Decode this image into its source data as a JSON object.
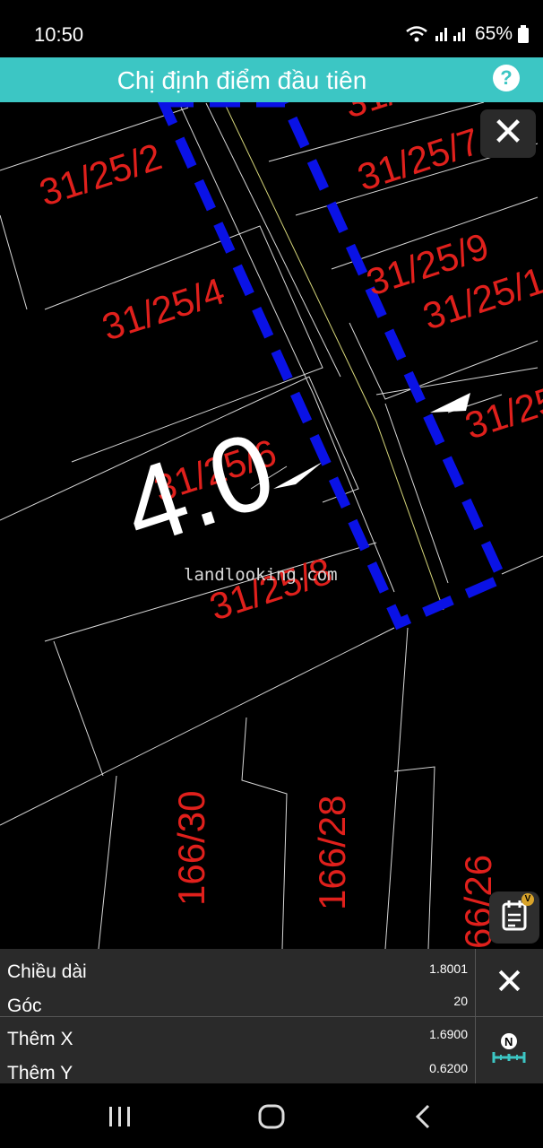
{
  "status": {
    "time": "10:50",
    "battery": "65%"
  },
  "header": {
    "title": "Chị định điểm đầu tiên",
    "help_label": "?"
  },
  "map": {
    "parcels": [
      "31/25/2",
      "31/25/4",
      "31/25/6",
      "31/25/8",
      "31/25/7",
      "31/25/9",
      "31/25/1",
      "31/25",
      "31/",
      "166/30",
      "166/28",
      "66/26"
    ],
    "measure_label": "4.0",
    "watermark": "landlooking.com",
    "close_label": "✕"
  },
  "note_badge": "V",
  "panel": {
    "rows": [
      {
        "label": "Chiều dài",
        "value": "1.8001"
      },
      {
        "label": "Góc",
        "value": "20"
      },
      {
        "label": "Thêm X",
        "value": "1.6900"
      },
      {
        "label": "Thêm Y",
        "value": "0.6200"
      }
    ],
    "close_label": "✕",
    "north_label": "N"
  },
  "colors": {
    "accent": "#3cc6c4",
    "parcel_label": "#e0201c",
    "boundary": "#0a12e6"
  }
}
